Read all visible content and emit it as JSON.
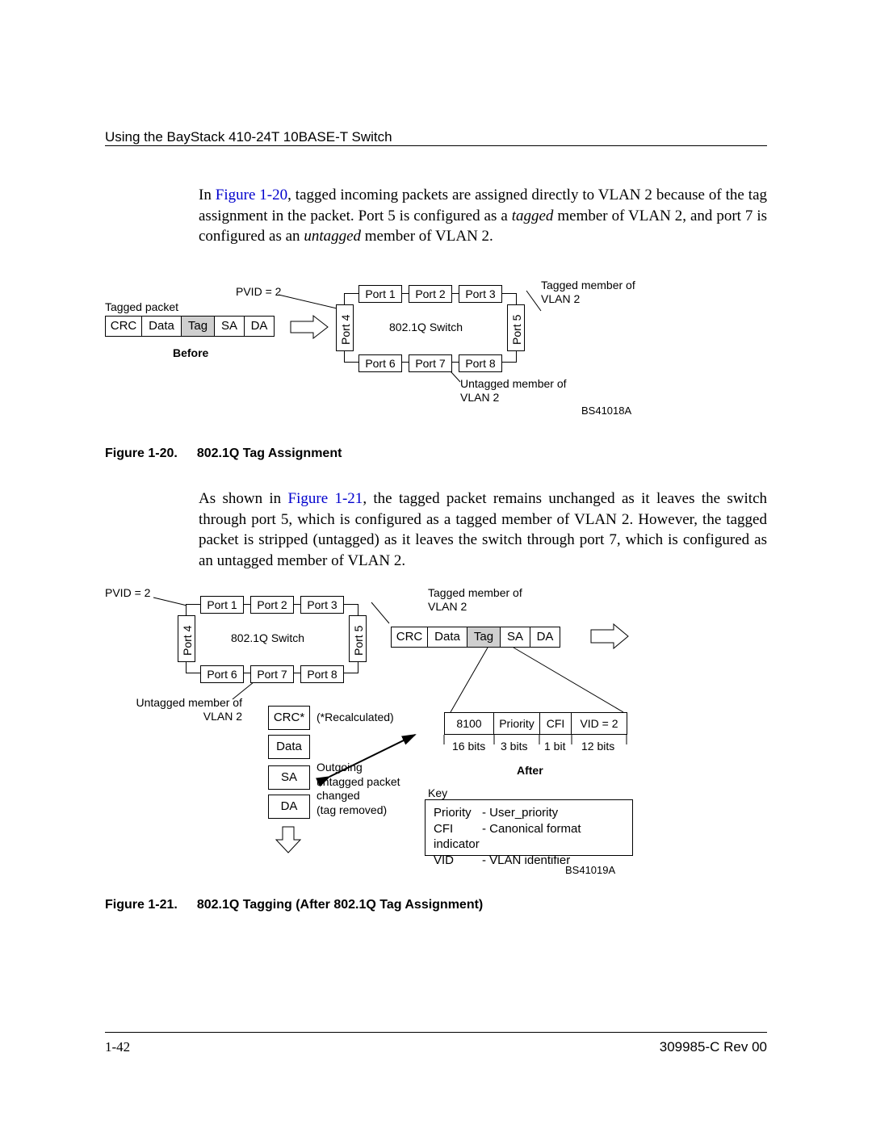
{
  "header": {
    "title": "Using the BayStack 410-24T 10BASE-T Switch"
  },
  "footer": {
    "page": "1-42",
    "doc": "309985-C Rev 00"
  },
  "para1": {
    "pre": "In ",
    "link": "Figure 1-20",
    "post1": ", tagged incoming packets are assigned directly to VLAN 2 because of the tag assignment in the packet. Port 5 is configured as a ",
    "it1": "tagged",
    "post2": " member of VLAN 2, and port 7 is configured as an ",
    "it2": "untagged",
    "post3": " member of VLAN 2."
  },
  "para2": {
    "pre": "As shown in ",
    "link": "Figure 1-21",
    "post": ", the tagged packet remains unchanged as it leaves the switch through port 5, which is configured as a tagged member of VLAN 2. However, the tagged packet is stripped (untagged) as it leaves the switch through port 7, which is configured as an untagged member of VLAN 2."
  },
  "caption1": {
    "num": "Figure 1-20.",
    "title": "802.1Q Tag Assignment"
  },
  "caption2": {
    "num": "Figure 1-21.",
    "title": "802.1Q Tagging (After 802.1Q Tag Assignment)"
  },
  "fig1": {
    "pvid": "PVID = 2",
    "taggedPacket": "Tagged packet",
    "before": "Before",
    "switchLabel": "802.1Q Switch",
    "taggedMember": "Tagged member of VLAN 2",
    "untaggedMember": "Untagged member of VLAN 2",
    "code": "BS41018A",
    "ports": {
      "p1": "Port 1",
      "p2": "Port 2",
      "p3": "Port 3",
      "p4": "Port 4",
      "p5": "Port 5",
      "p6": "Port 6",
      "p7": "Port 7",
      "p8": "Port 8"
    },
    "pkt": {
      "crc": "CRC",
      "data": "Data",
      "tag": "Tag",
      "sa": "SA",
      "da": "DA"
    }
  },
  "fig2": {
    "pvid": "PVID = 2",
    "switchLabel": "802.1Q Switch",
    "taggedMember": "Tagged member of VLAN 2",
    "untaggedMember": "Untagged member of VLAN 2",
    "recalc": "(*Recalculated)",
    "outgoing1": "Outgoing",
    "outgoing2": "untagged packet",
    "outgoing3": "changed",
    "outgoing4": "(tag removed)",
    "after": "After",
    "keyTitle": "Key",
    "key": {
      "r1a": "Priority",
      "r1b": "- User_priority",
      "r2a": "CFI",
      "r2b": "- Canonical format indicator",
      "r3a": "VID",
      "r3b": "- VLAN identifier"
    },
    "tag": {
      "a": "8100",
      "b": "Priority",
      "c": "CFI",
      "d": "VID = 2"
    },
    "bits": {
      "a": "16 bits",
      "b": "3 bits",
      "c": "1 bit",
      "d": "12 bits"
    },
    "ports": {
      "p1": "Port 1",
      "p2": "Port 2",
      "p3": "Port 3",
      "p4": "Port 4",
      "p5": "Port 5",
      "p6": "Port 6",
      "p7": "Port 7",
      "p8": "Port 8"
    },
    "pkt": {
      "crc": "CRC",
      "data": "Data",
      "tag": "Tag",
      "sa": "SA",
      "da": "DA",
      "crcstar": "CRC*"
    },
    "code": "BS41019A"
  }
}
